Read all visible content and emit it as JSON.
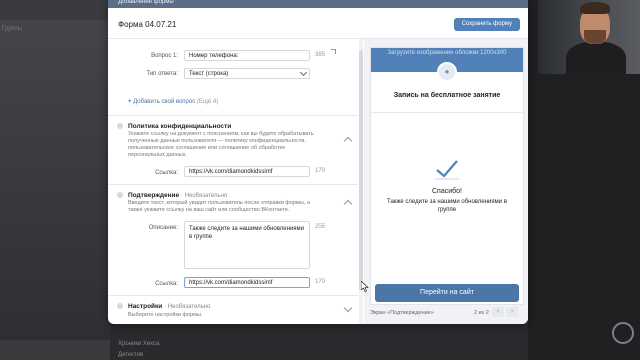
{
  "modal": {
    "top_title": "Добавление формы",
    "form_title": "Форма 04.07.21",
    "save_label": "Сохранить форму"
  },
  "question": {
    "label": "Вопрос 1:",
    "value": "Номер телефона:",
    "counter": "385",
    "answer_type_label": "Тип ответа:",
    "answer_type_value": "Текст (строка)"
  },
  "add_question": {
    "label": "Добавить свой вопрос",
    "hint": "(Ещё 4)"
  },
  "privacy": {
    "title": "Политика конфиденциальности",
    "description": "Укажите ссылку на документ с пояснением, как вы будете обрабатывать полученные данные пользователя — политику конфиденциальности, пользовательское соглашение или соглашение об обработке персональных данных.",
    "link_label": "Ссылка:",
    "link_value": "https://vk.com/diamondkidssimf",
    "counter": "170"
  },
  "confirmation": {
    "title": "Подтверждение",
    "optional": "· Необязательно",
    "description": "Введите текст, который увидит пользователь после отправки формы, а также укажите ссылку на ваш сайт или сообщество ВКонтакте.",
    "desc_label": "Описание:",
    "desc_value": "Также следите за нашими обновлениями в группе",
    "desc_counter": "255",
    "link_label": "Ссылка:",
    "link_value": "https://vk.com/diamondkidssimf",
    "link_counter": "170"
  },
  "settings": {
    "title": "Настройки",
    "optional": "· Необязательно",
    "description": "Выберите настройки формы."
  },
  "preview": {
    "cover_text": "Загрузите изображение обложки 1200х300",
    "title": "Запись на бесплатное занятие",
    "thanks": "Спасибо!",
    "thanks_desc": "Также следите за нашими обновлениями в группе",
    "go_button": "Перейти на сайт",
    "footer_label": "Экран «Подтверждение»",
    "page": "2 из 2"
  },
  "background": {
    "left_top": "Группы",
    "bottom_1": "Хроники Хекса",
    "bottom_2": "Детектив"
  },
  "icons": [
    "check-icon",
    "chevron-up-icon",
    "chevron-down-icon",
    "plus-icon",
    "avatar-icon",
    "arrow-left-icon",
    "arrow-right-icon",
    "cursor-icon"
  ],
  "colors": {
    "accent": "#5181b8",
    "button": "#4a76a8",
    "link": "#4a76a8"
  }
}
